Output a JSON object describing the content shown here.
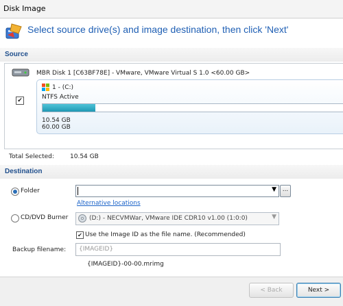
{
  "window": {
    "title": "Disk Image"
  },
  "header": {
    "instruction": "Select source drive(s) and image destination, then click 'Next'"
  },
  "source": {
    "heading": "Source",
    "disk_label": "MBR Disk 1 [C63BF78E] - VMware,  VMware Virtual S 1.0  <60.00 GB>",
    "partition": {
      "checked": true,
      "name": "1 - (C:)",
      "fs": "NTFS Active",
      "used": "10.54 GB",
      "total": "60.00 GB",
      "used_fraction": 0.176
    },
    "total_selected_label": "Total Selected:",
    "total_selected_value": "10.54 GB"
  },
  "destination": {
    "heading": "Destination",
    "folder_label": "Folder",
    "folder_value": "",
    "alt_locations": "Alternative locations",
    "browse_label": "...",
    "cd_label": "CD/DVD Burner",
    "cd_value": "(D:) - NECVMWar, VMware IDE CDR10 v1.00 (1:0:0)",
    "use_image_id_label": "Use the Image ID as the file name.  (Recommended)",
    "use_image_id_checked": true,
    "backup_filename_label": "Backup filename:",
    "backup_filename_placeholder": "{IMAGEID}",
    "filename_preview": "{IMAGEID}-00-00.mrimg"
  },
  "footer": {
    "back_label": "< Back",
    "next_label": "Next >"
  },
  "colors": {
    "accent": "#1f5fb4",
    "heading": "#1f4e8c",
    "usage_bar": "#1f98b4"
  },
  "icons": {
    "wizard": "disk-image-wizard-icon",
    "disk": "hard-disk-icon",
    "partition": "windows-logo-icon",
    "cd": "cd-drive-icon"
  }
}
